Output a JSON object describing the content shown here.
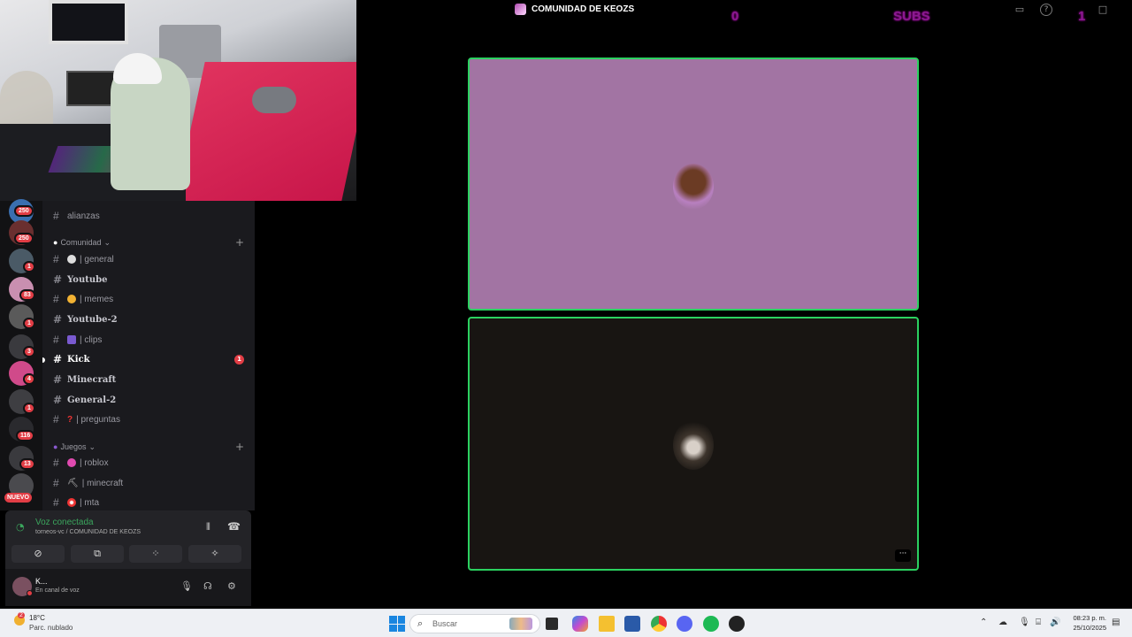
{
  "window": {
    "title": "COMUNIDAD DE KEOZS",
    "overlay_left": "0",
    "overlay_subs": "SUBS",
    "overlay_right": "1"
  },
  "servers": [
    {
      "badge": "250"
    },
    {
      "badge": "250"
    },
    {
      "badge": "1"
    },
    {
      "badge": "83"
    },
    {
      "badge": "1"
    },
    {
      "badge": "3"
    },
    {
      "badge": "4"
    },
    {
      "badge": "1"
    },
    {
      "badge": "116"
    },
    {
      "badge": "13"
    }
  ],
  "servers_nuevo": "NUEVO",
  "channels": {
    "alianzas": "alianzas",
    "cat_comunidad": "Comunidad",
    "general": "| general",
    "youtube": "Youtube",
    "memes": "| memes",
    "youtube2": "Youtube-2",
    "clips": "| clips",
    "kick": "Kick",
    "kick_unread": "1",
    "minecraft_bold": "Minecraft",
    "general2": "General-2",
    "preguntas": "| preguntas",
    "cat_juegos": "Juegos",
    "roblox": "| roblox",
    "minecraft": "| minecraft",
    "mta": "| mta"
  },
  "voice": {
    "status": "Voz conectada",
    "location": "torneos-vc / COMUNIDAD DE KEOZS"
  },
  "user": {
    "name": "K...",
    "status": "En canal de voz"
  },
  "taskbar": {
    "weather_temp": "18°C",
    "weather_desc": "Parc. nublado",
    "weather_badge": "2",
    "search_placeholder": "Buscar",
    "time": "08:23 p. m.",
    "date": "25/10/2025"
  }
}
